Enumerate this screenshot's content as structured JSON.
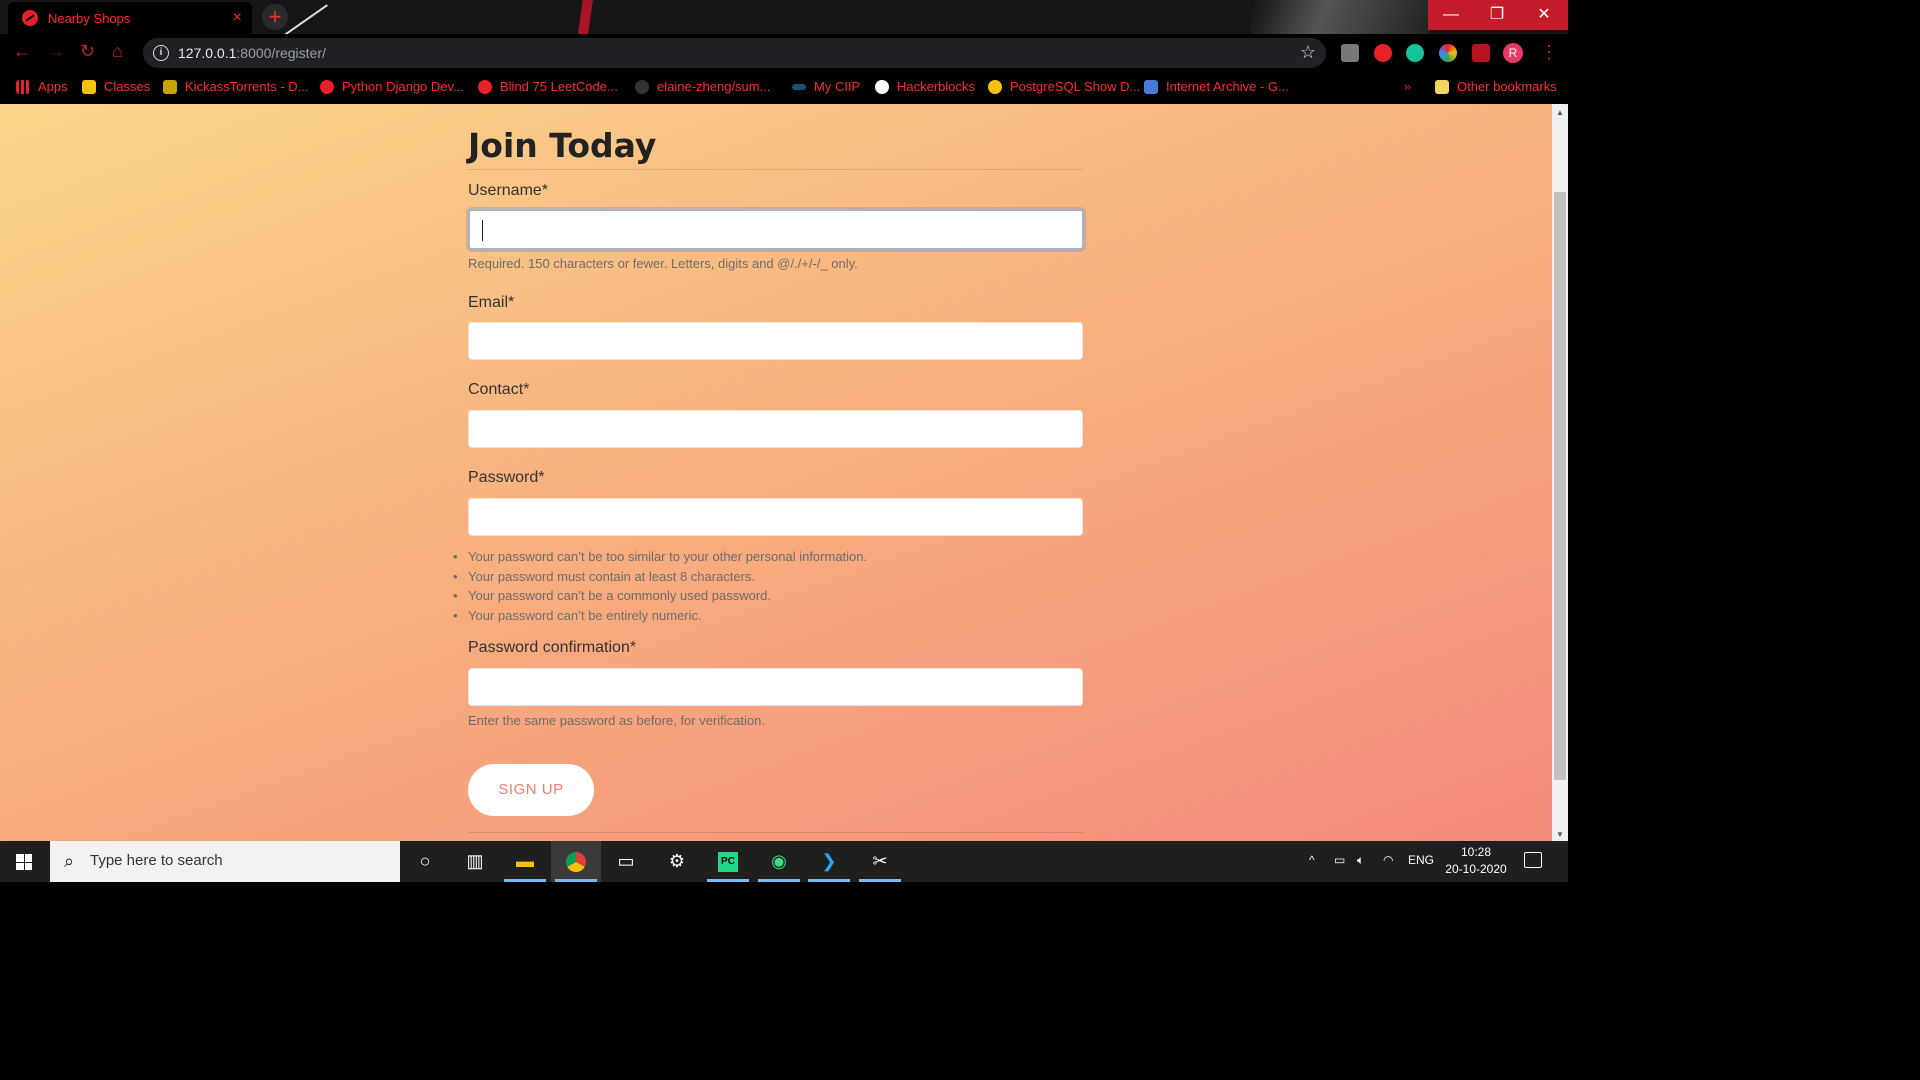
{
  "browser": {
    "tab_title": "Nearby Shops",
    "tab_close": "×",
    "new_tab": "+",
    "url_host": "127.0.0.1",
    "url_rest": ":8000/register/",
    "avatar_letter": "R",
    "window_controls": {
      "minimize": "—",
      "maximize": "❐",
      "close": "✕"
    }
  },
  "bookmarks": [
    {
      "label": "Apps",
      "color": "#4285f4"
    },
    {
      "label": "Classes",
      "color": "#f4c20d"
    },
    {
      "label": "KickassTorrents - D...",
      "color": "#c8a400"
    },
    {
      "label": "Python Django Dev...",
      "color": "#e8202a"
    },
    {
      "label": "Blind 75 LeetCode...",
      "color": "#e8202a"
    },
    {
      "label": "elaine-zheng/sum...",
      "color": "#333333"
    },
    {
      "label": "My CIIP",
      "color": "#1e88e5"
    },
    {
      "label": "Hackerblocks",
      "color": "#ffffff"
    },
    {
      "label": "PostgreSQL Show D...",
      "color": "#f4c20d"
    },
    {
      "label": "Internet Archive - G...",
      "color": "#4a7bd8"
    },
    {
      "label": "Other bookmarks",
      "color": "#f4d35e"
    }
  ],
  "form": {
    "heading": "Join Today",
    "username_label": "Username*",
    "username_help": "Required. 150 characters or fewer. Letters, digits and @/./+/-/_ only.",
    "email_label": "Email*",
    "contact_label": "Contact*",
    "password_label": "Password*",
    "password_rules": [
      "Your password can’t be too similar to your other personal information.",
      "Your password must contain at least 8 characters.",
      "Your password can’t be a commonly used password.",
      "Your password can’t be entirely numeric."
    ],
    "password2_label": "Password confirmation*",
    "password2_help": "Enter the same password as before, for verification.",
    "submit_label": "SIGN UP"
  },
  "taskbar": {
    "search_placeholder": "Type here to search",
    "language": "ENG",
    "time": "10:28",
    "date": "20-10-2020"
  }
}
